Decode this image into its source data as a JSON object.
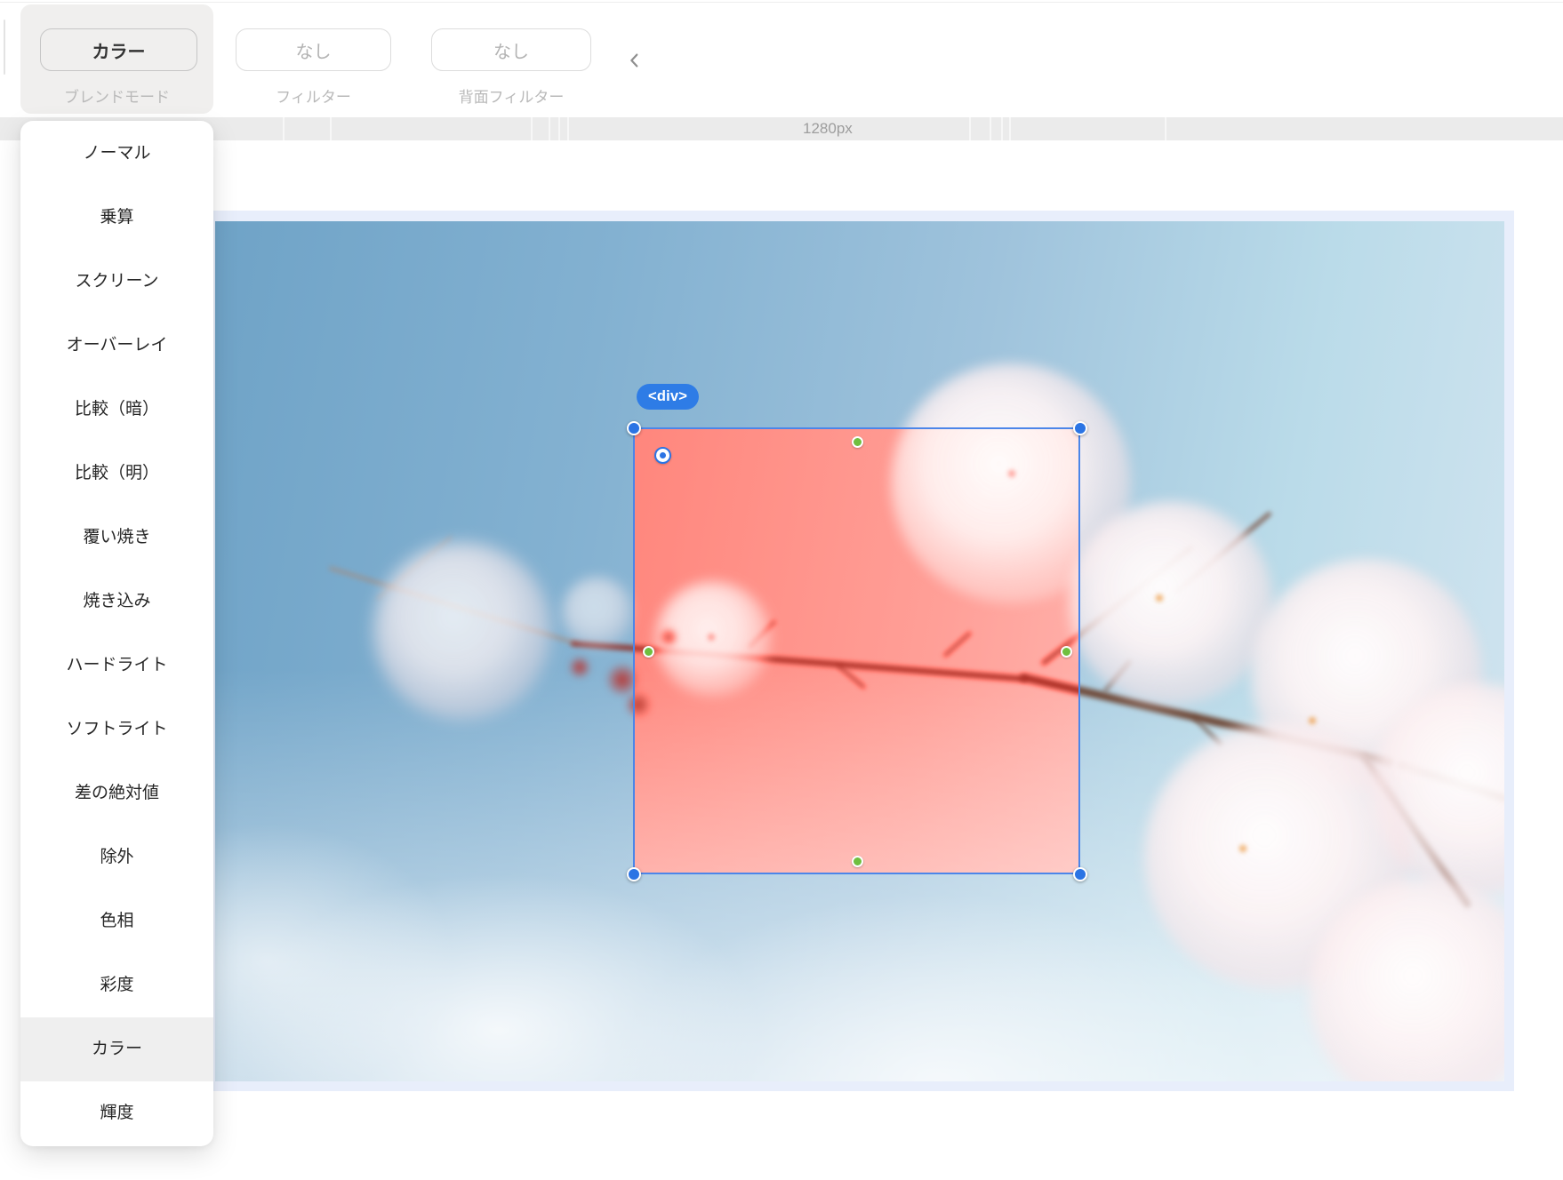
{
  "toolbar": {
    "blend_mode": {
      "value": "カラー",
      "label": "ブレンドモード"
    },
    "filter": {
      "value": "なし",
      "label": "フィルター"
    },
    "backdrop_filter": {
      "value": "なし",
      "label": "背面フィルター"
    }
  },
  "ruler": {
    "width_label": "1280px"
  },
  "blend_menu": {
    "selected_index": 14,
    "items": [
      "ノーマル",
      "乗算",
      "スクリーン",
      "オーバーレイ",
      "比較（暗）",
      "比較（明）",
      "覆い焼き",
      "焼き込み",
      "ハードライト",
      "ソフトライト",
      "差の絶対値",
      "除外",
      "色相",
      "彩度",
      "カラー",
      "輝度"
    ]
  },
  "canvas": {
    "selected_element_tag": "<div>"
  },
  "colors": {
    "accent_blue": "#2e7ce6",
    "selection_border": "#4c86e9",
    "handle_green": "#6fbf3f",
    "overlay_red": "#f2756b",
    "section_padding_blue": "#e8eefb"
  }
}
